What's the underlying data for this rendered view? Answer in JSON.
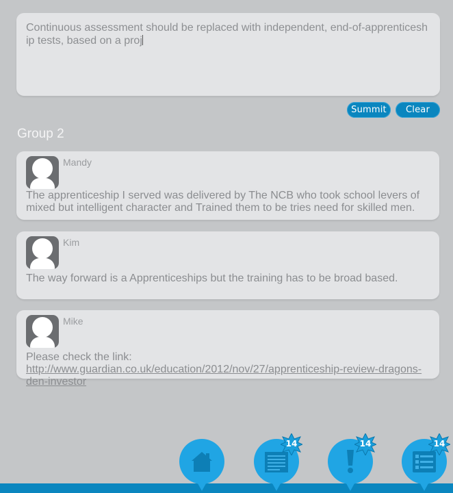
{
  "compose": {
    "text": "Continuous assessment should be replaced with independent, end-of-apprenticeship tests, based on a proj"
  },
  "buttons": {
    "submit_label": "Summit",
    "clear_label": "Clear"
  },
  "group": {
    "title": "Group 2"
  },
  "posts": [
    {
      "author": "Mandy",
      "text": "The apprenticeship I served was delivered by The NCB who took school levers of mixed but intelligent character and Trained them to be tries need for skilled men."
    },
    {
      "author": "Kim",
      "text": "The way forward is a Apprenticeships but the training has to be broad based."
    },
    {
      "author": "Mike",
      "text_prefix": "Please check the link: ",
      "link": "http://www.guardian.co.uk/education/2012/nov/27/apprenticeship-review-dragons-den-investor"
    }
  ],
  "nav": {
    "items": [
      {
        "icon": "home-icon",
        "badge": null
      },
      {
        "icon": "document-icon",
        "badge": "14"
      },
      {
        "icon": "alert-icon",
        "badge": "14"
      },
      {
        "icon": "list-icon",
        "badge": "14"
      }
    ]
  },
  "colors": {
    "background": "#c4c6c8",
    "card": "#e3e4e6",
    "accent": "#0a86bf",
    "nav_bubble": "#20a5e4"
  }
}
